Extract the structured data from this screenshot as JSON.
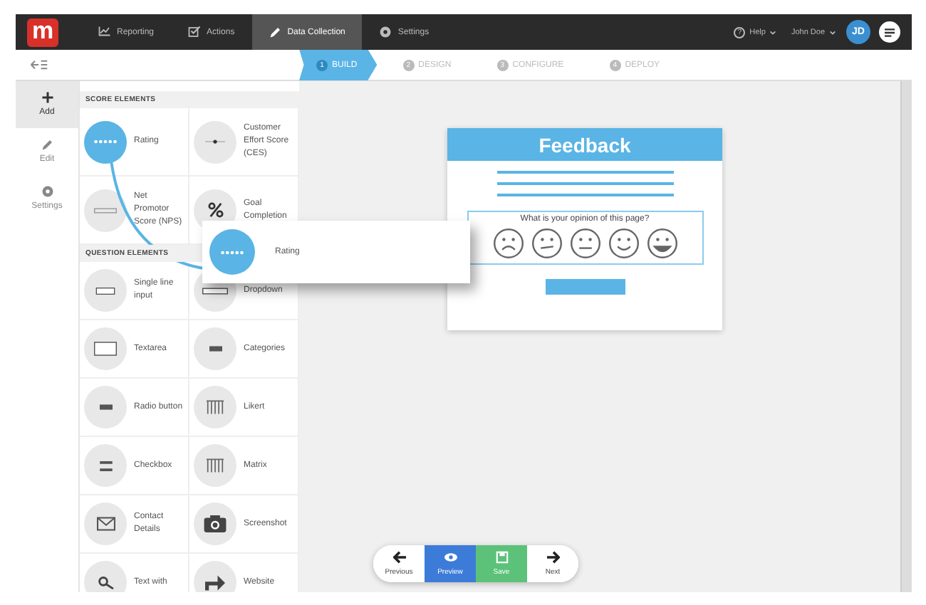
{
  "nav": {
    "logo": "m",
    "items": [
      {
        "label": "Reporting",
        "selected": false
      },
      {
        "label": "Actions",
        "selected": false
      },
      {
        "label": "Data Collection",
        "selected": true
      },
      {
        "label": "Settings",
        "selected": false
      }
    ],
    "help_mark": "?",
    "help": "Help",
    "user": "John Doe",
    "avatar": "JD"
  },
  "steps": [
    {
      "number": "1",
      "label": "BUILD",
      "selected": true
    },
    {
      "number": "2",
      "label": "DESIGN",
      "selected": false
    },
    {
      "number": "3",
      "label": "CONFIGURE",
      "selected": false
    },
    {
      "number": "4",
      "label": "DEPLOY",
      "selected": false
    }
  ],
  "rail": [
    {
      "label": "Add",
      "selected": true
    },
    {
      "label": "Edit",
      "selected": false
    },
    {
      "label": "Settings",
      "selected": false
    }
  ],
  "sections": [
    {
      "title": "SCORE ELEMENTS",
      "elements": [
        {
          "label": "Rating",
          "kind": "stars",
          "selected": true
        },
        {
          "label": "Customer Effort Score (CES)",
          "kind": "slider",
          "selected": false
        },
        {
          "label": "Net Promotor Score (NPS)",
          "kind": "scale",
          "selected": false
        },
        {
          "label": "Goal Completion",
          "kind": "percent",
          "selected": false
        }
      ]
    },
    {
      "title": "QUESTION ELEMENTS",
      "elements": [
        {
          "label": "Single line input",
          "kind": "input",
          "selected": false
        },
        {
          "label": "Dropdown",
          "kind": "dropdown",
          "selected": false
        },
        {
          "label": "Textarea",
          "kind": "textarea",
          "selected": false
        },
        {
          "label": "Categories",
          "kind": "bar",
          "selected": false
        },
        {
          "label": "Radio button",
          "kind": "bar",
          "selected": false
        },
        {
          "label": "Likert",
          "kind": "grid",
          "selected": false
        },
        {
          "label": "Checkbox",
          "kind": "lines",
          "selected": false
        },
        {
          "label": "Matrix",
          "kind": "grid",
          "selected": false
        },
        {
          "label": "Contact Details",
          "kind": "mail",
          "selected": false
        },
        {
          "label": "Screenshot",
          "kind": "camera",
          "selected": false
        },
        {
          "label": "Text with",
          "kind": "key",
          "selected": false
        },
        {
          "label": "Website",
          "kind": "share",
          "selected": false
        }
      ]
    }
  ],
  "drag": {
    "label": "Rating"
  },
  "feedback": {
    "title": "Feedback",
    "question": "What is your opinion of this page?"
  },
  "toolbar": [
    {
      "label": "Previous",
      "kind": "prev"
    },
    {
      "label": "Preview",
      "kind": "preview"
    },
    {
      "label": "Save",
      "kind": "save"
    },
    {
      "label": "Next",
      "kind": "next"
    }
  ]
}
